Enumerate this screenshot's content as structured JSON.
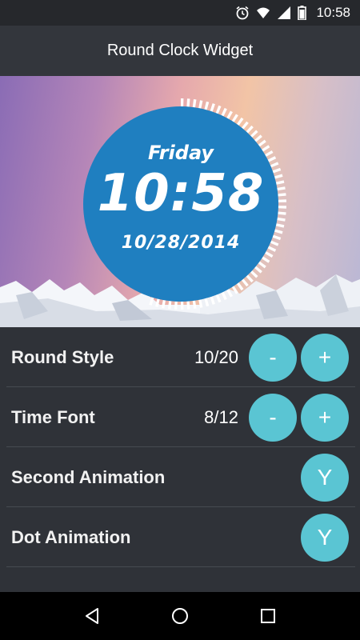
{
  "status_bar": {
    "time": "10:58",
    "icons": [
      "alarm-icon",
      "wifi-icon",
      "signal-icon",
      "battery-icon"
    ]
  },
  "header": {
    "title": "Round Clock Widget"
  },
  "preview": {
    "day": "Friday",
    "time": "10:58",
    "date": "10/28/2014",
    "clock_color": "#1f7fc0"
  },
  "settings": [
    {
      "label": "Round Style",
      "value": "10/20",
      "minus": "-",
      "plus": "+"
    },
    {
      "label": "Time Font",
      "value": "8/12",
      "minus": "-",
      "plus": "+"
    },
    {
      "label": "Second Animation",
      "toggle": "Y"
    },
    {
      "label": "Dot Animation",
      "toggle": "Y"
    }
  ],
  "colors": {
    "accent": "#5ac5d3",
    "background": "#2f3238"
  },
  "nav_bar": {
    "icons": [
      "back-icon",
      "home-icon",
      "recents-icon"
    ]
  }
}
